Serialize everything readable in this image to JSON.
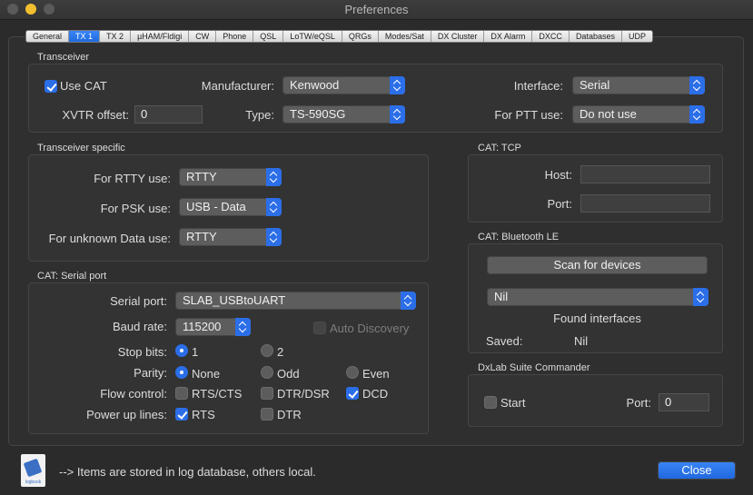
{
  "window": {
    "title": "Preferences"
  },
  "tabs": [
    "General",
    "TX 1",
    "TX 2",
    "µHAM/Fldigi",
    "CW",
    "Phone",
    "QSL",
    "LoTW/eQSL",
    "QRGs",
    "Modes/Sat",
    "DX Cluster",
    "DX Alarm",
    "DXCC",
    "Databases",
    "UDP"
  ],
  "active_tab": "TX 1",
  "transceiver": {
    "title": "Transceiver",
    "use_cat_label": "Use CAT",
    "use_cat_checked": true,
    "manufacturer_label": "Manufacturer:",
    "manufacturer_value": "Kenwood",
    "interface_label": "Interface:",
    "interface_value": "Serial",
    "xvtr_label": "XVTR offset:",
    "xvtr_value": "0",
    "type_label": "Type:",
    "type_value": "TS-590SG",
    "ptt_label": "For PTT use:",
    "ptt_value": "Do not use"
  },
  "transceiver_specific": {
    "title": "Transceiver specific",
    "rtty_label": "For RTTY use:",
    "rtty_value": "RTTY",
    "psk_label": "For PSK use:",
    "psk_value": "USB - Data",
    "unknown_label": "For unknown Data use:",
    "unknown_value": "RTTY"
  },
  "cat_tcp": {
    "title": "CAT: TCP",
    "host_label": "Host:",
    "host_value": "",
    "port_label": "Port:",
    "port_value": ""
  },
  "cat_ble": {
    "title": "CAT: Bluetooth LE",
    "scan_button": "Scan for devices",
    "device_value": "Nil",
    "found_label": "Found interfaces",
    "saved_label": "Saved:",
    "saved_value": "Nil"
  },
  "cat_serial": {
    "title": "CAT: Serial port",
    "serial_port_label": "Serial port:",
    "serial_port_value": "SLAB_USBtoUART",
    "baud_label": "Baud rate:",
    "baud_value": "115200",
    "auto_discovery_label": "Auto Discovery",
    "stop_bits_label": "Stop bits:",
    "stop_bits_options": [
      "1",
      "2"
    ],
    "stop_bits_selected": "1",
    "parity_label": "Parity:",
    "parity_options": [
      "None",
      "Odd",
      "Even"
    ],
    "parity_selected": "None",
    "flow_label": "Flow control:",
    "flow_options": [
      {
        "label": "RTS/CTS",
        "checked": false
      },
      {
        "label": "DTR/DSR",
        "checked": false
      },
      {
        "label": "DCD",
        "checked": true
      }
    ],
    "power_label": "Power up lines:",
    "power_options": [
      {
        "label": "RTS",
        "checked": true
      },
      {
        "label": "DTR",
        "checked": false
      }
    ]
  },
  "dxlab": {
    "title": "DxLab Suite Commander",
    "start_label": "Start",
    "start_checked": false,
    "port_label": "Port:",
    "port_value": "0"
  },
  "footer": {
    "note": "--> Items are stored in log database, others local.",
    "close_button": "Close",
    "app_icon_text": "logbook"
  },
  "colors": {
    "accent": "#2b6ee8",
    "background": "#2b2b2b"
  }
}
